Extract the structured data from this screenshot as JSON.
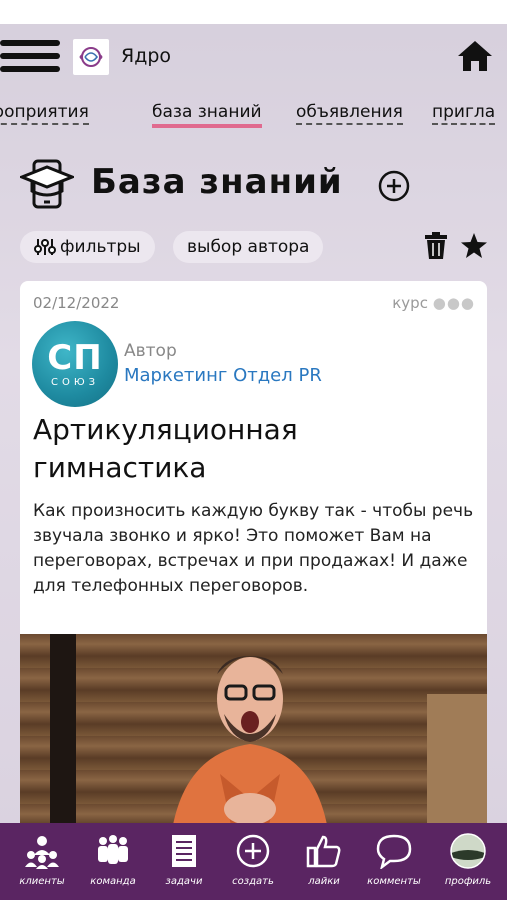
{
  "app": {
    "name": "Ядро"
  },
  "tabs": [
    {
      "label": "мероприятия"
    },
    {
      "label": "база знаний"
    },
    {
      "label": "объявления"
    },
    {
      "label": "пригла"
    }
  ],
  "section": {
    "title": "База знаний"
  },
  "filters": {
    "filters_label": "фильтры",
    "author_label": "выбор автора"
  },
  "card": {
    "date": "02/12/2022",
    "type": "курс",
    "avatar_text": "СП",
    "avatar_subtext": "СОЮЗ",
    "author_caption": "Автор",
    "author_name": "Маркетинг Отдел PR",
    "title": "Артикуляционная гимнастика",
    "description": "Как произносить каждую букву так - чтобы речь звучала звонко и ярко! Это поможет Вам на переговорах, встречах и при продажах! И даже для телефонных переговоров."
  },
  "bottom_nav": [
    {
      "label": "клиенты",
      "icon": "clients-icon"
    },
    {
      "label": "команда",
      "icon": "team-icon"
    },
    {
      "label": "задачи",
      "icon": "tasks-icon"
    },
    {
      "label": "создать",
      "icon": "create-icon"
    },
    {
      "label": "лайки",
      "icon": "like-icon"
    },
    {
      "label": "комменты",
      "icon": "comment-icon"
    },
    {
      "label": "профиль",
      "icon": "profile-icon"
    }
  ],
  "colors": {
    "accent_tab": "#e06a8f",
    "bottom_bar": "#5a2562",
    "author_link": "#2a78c0"
  }
}
